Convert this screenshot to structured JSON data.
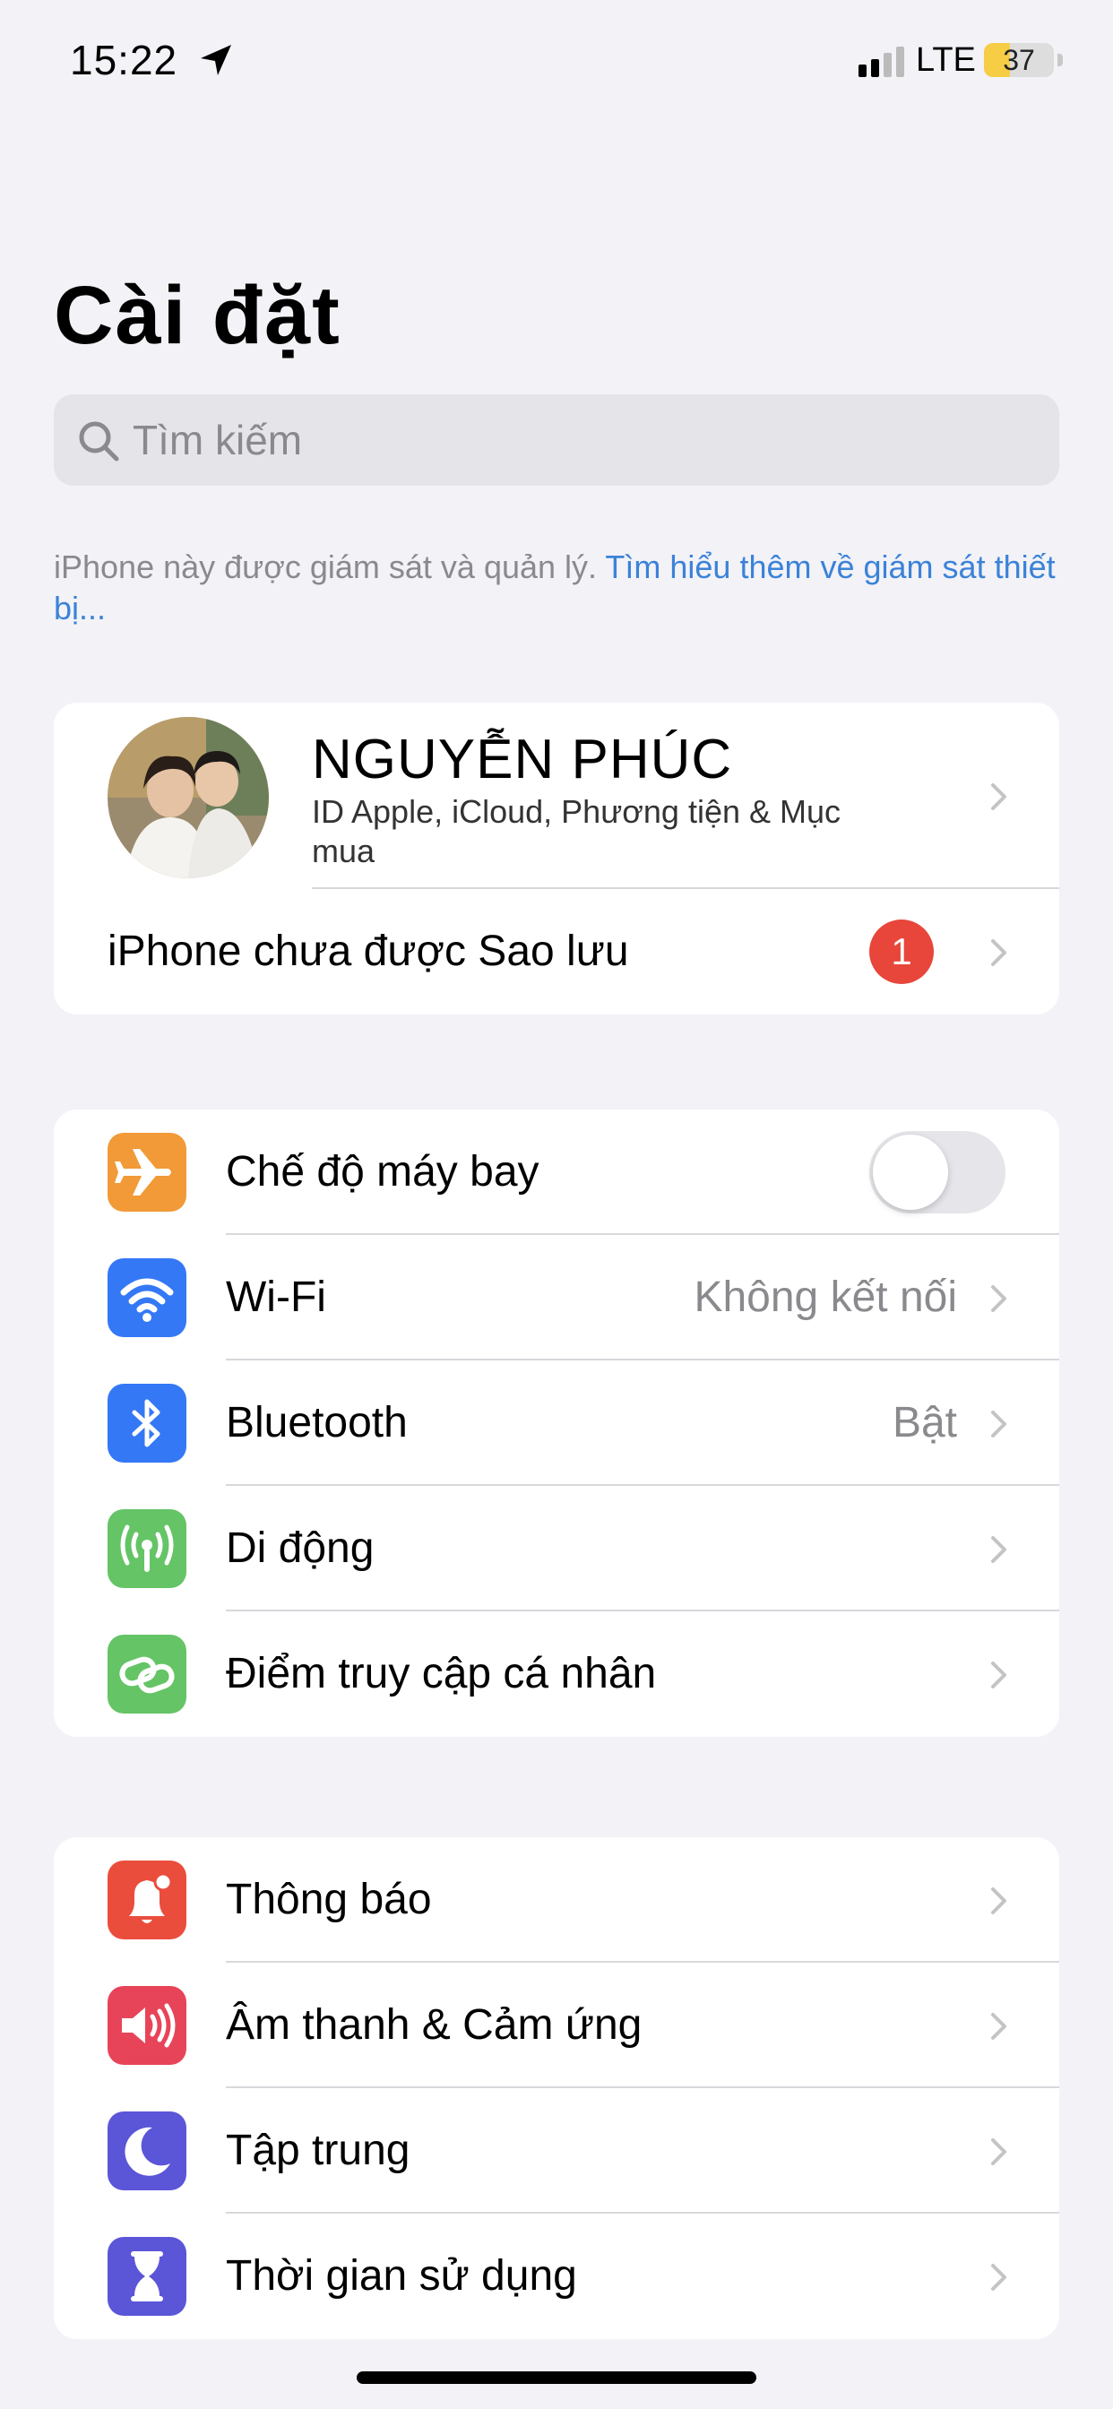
{
  "status_bar": {
    "time": "15:22",
    "network": "LTE",
    "battery_percent": 37,
    "battery_text": "37",
    "battery_color": "#f7cd46"
  },
  "title": "Cài đặt",
  "search": {
    "placeholder": "Tìm kiếm"
  },
  "note": {
    "text": "iPhone này được giám sát và quản lý. ",
    "link": "Tìm hiểu thêm về giám sát thiết bị..."
  },
  "profile": {
    "name": "NGUYỄN PHÚC",
    "subtitle": "ID Apple, iCloud, Phương tiện & Mục mua"
  },
  "backup": {
    "label": "iPhone chưa được Sao lưu",
    "badge": "1"
  },
  "connectivity": {
    "airplane": {
      "label": "Chế độ máy bay",
      "icon": "airplane-icon",
      "color": "#f19a37",
      "enabled": false
    },
    "wifi": {
      "label": "Wi-Fi",
      "value": "Không kết nối",
      "icon": "wifi-icon",
      "color": "#3478f6"
    },
    "bluetooth": {
      "label": "Bluetooth",
      "value": "Bật",
      "icon": "bluetooth-icon",
      "color": "#3478f6"
    },
    "cellular": {
      "label": "Di động",
      "icon": "cellular-antenna-icon",
      "color": "#65c466"
    },
    "hotspot": {
      "label": "Điểm truy cập cá nhân",
      "icon": "hotspot-link-icon",
      "color": "#65c466"
    }
  },
  "system": {
    "notifications": {
      "label": "Thông báo",
      "icon": "bell-icon",
      "color": "#eb4d3d"
    },
    "sounds": {
      "label": "Âm thanh & Cảm ứng",
      "icon": "speaker-icon",
      "color": "#e84459"
    },
    "focus": {
      "label": "Tập trung",
      "icon": "moon-icon",
      "color": "#5b55d8"
    },
    "screen_time": {
      "label": "Thời gian sử dụng",
      "icon": "hourglass-icon",
      "color": "#5b55d8"
    }
  }
}
